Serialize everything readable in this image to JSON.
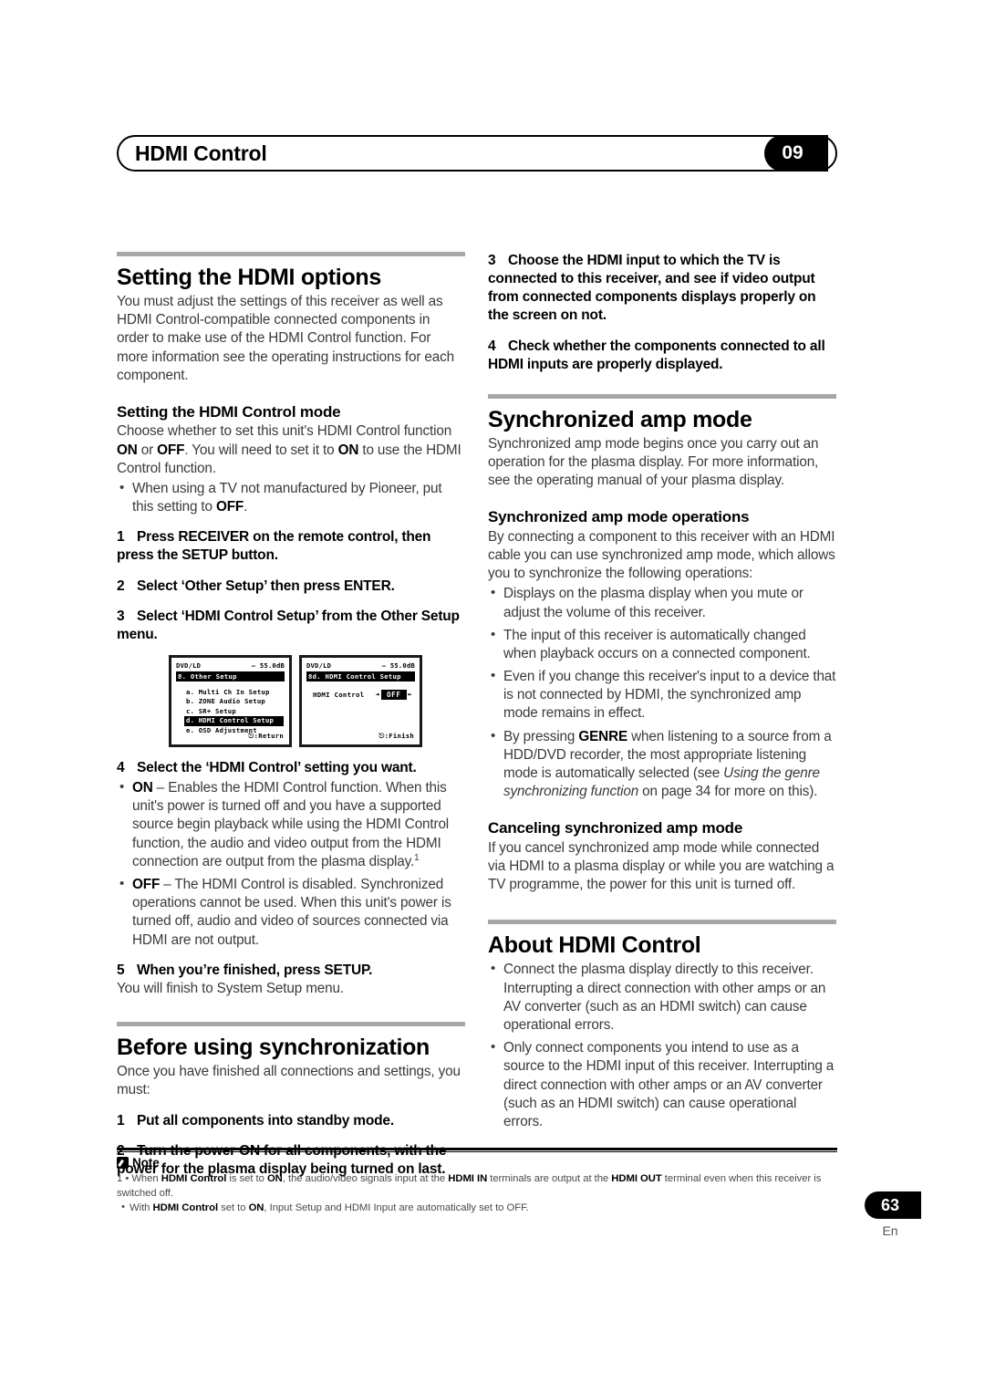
{
  "header": {
    "running_title": "HDMI Control",
    "chapter_number": "09"
  },
  "left_column": {
    "section1": {
      "heading": "Setting the HDMI options",
      "intro": "You must adjust the settings of this receiver as well as HDMI Control-compatible connected components in order to make use of the HDMI Control function. For more information see the operating instructions for each component.",
      "subheading": "Setting the HDMI Control mode",
      "sub_intro_pre": "Choose whether to set this unit's HDMI Control function ",
      "sub_on": "ON",
      "sub_mid1": " or ",
      "sub_off": "OFF",
      "sub_mid2": ". You will need to set it to ",
      "sub_on2": "ON",
      "sub_end": " to use the HDMI Control function.",
      "bullet1_pre": "When using a TV not manufactured by Pioneer, put this setting to ",
      "bullet1_bold": "OFF",
      "bullet1_end": ".",
      "steps": [
        {
          "n": "1",
          "text": "Press RECEIVER on the remote control, then press the SETUP button."
        },
        {
          "n": "2",
          "text": "Select ‘Other Setup’ then press ENTER."
        },
        {
          "n": "3",
          "text": "Select ‘HDMI Control Setup’ from the Other Setup menu."
        }
      ],
      "step4": {
        "n": "4",
        "text": "Select the ‘HDMI Control’ setting you want."
      },
      "step4_bullets": [
        {
          "bold": "ON",
          "text": " – Enables the HDMI Control function. When this unit's power is turned off and you have a supported source begin playback while using the HDMI Control function, the audio and video output from the HDMI connection are output from the plasma display.",
          "footnote": "1"
        },
        {
          "bold": "OFF",
          "text": " – The HDMI Control is disabled. Synchronized operations cannot be used. When this unit's power is turned off, audio and video of sources connected via HDMI are not output.",
          "footnote": ""
        }
      ],
      "step5": {
        "n": "5",
        "text": "When you’re finished, press SETUP."
      },
      "step5_after": "You will finish to System Setup menu."
    },
    "section2": {
      "heading": "Before using synchronization",
      "intro": "Once you have finished all connections and settings, you must:",
      "steps": [
        {
          "n": "1",
          "text": "Put all components into standby mode."
        },
        {
          "n": "2",
          "text": "Turn the power ON for all components, with the power for the plasma display being turned on last."
        }
      ]
    },
    "osd_screens": [
      {
        "source": "DVD/LD",
        "volume": "– 55.0dB",
        "title": "8. Other Setup",
        "items": [
          {
            "label": "a. Multi Ch In Setup",
            "highlighted": false
          },
          {
            "label": "b. ZONE Audio Setup",
            "highlighted": false
          },
          {
            "label": "c. SR+ Setup",
            "highlighted": false
          },
          {
            "label": "d. HDMI Control Setup",
            "highlighted": true
          },
          {
            "label": "e. OSD Adjustment",
            "highlighted": false
          }
        ],
        "footer": ":Return"
      },
      {
        "source": "DVD/LD",
        "volume": "– 55.0dB",
        "title": "8d. HDMI Control Setup",
        "field_label": "HDMI Control",
        "field_value": "OFF",
        "arrow_left": "◄",
        "arrow_right": "►",
        "footer": ":Finish"
      }
    ]
  },
  "right_column": {
    "continued_steps": [
      {
        "n": "3",
        "text": "Choose the HDMI input to which the TV is connected to this receiver, and see if video output from connected components displays properly on the screen on not."
      },
      {
        "n": "4",
        "text": "Check whether the components connected to all HDMI inputs are properly displayed."
      }
    ],
    "section3": {
      "heading": "Synchronized amp mode",
      "intro": "Synchronized amp mode begins once you carry out an operation for the plasma display. For more information, see the operating manual of your plasma display.",
      "subheading": "Synchronized amp mode operations",
      "sub_intro": "By connecting a component to this receiver with an HDMI cable you can use synchronized amp mode, which allows you to synchronize the following operations:",
      "bullets": [
        "Displays on the plasma display when you mute or adjust the volume of this receiver.",
        "The input of this receiver is automatically changed when playback occurs on a connected component.",
        "Even if you change this receiver's input to a device that is not connected by HDMI, the synchronized amp mode remains in effect."
      ],
      "bullet_genre": {
        "pre": "By pressing ",
        "bold": "GENRE",
        "mid": " when listening to a source from a HDD/DVD recorder, the most appropriate listening mode is automatically selected (see ",
        "italic": "Using the genre synchronizing function",
        "post": " on page 34 for more on this)."
      },
      "subheading2": "Canceling synchronized amp mode",
      "sub_intro2": "If you cancel synchronized amp mode while connected via HDMI to a plasma display or while you are watching a TV programme, the power for this unit is turned off."
    },
    "section4": {
      "heading": "About HDMI Control",
      "bullets": [
        "Connect the plasma display directly to this receiver. Interrupting a direct connection with other amps or an AV converter (such as an HDMI switch) can cause operational errors.",
        "Only connect components you intend to use as a source to the HDMI input of this receiver. Interrupting a direct connection with other amps or an AV converter (such as an HDMI switch) can cause operational errors."
      ]
    }
  },
  "note": {
    "title": "Note",
    "line1": {
      "marker": "1",
      "pre": " • When ",
      "b1": "HDMI Control",
      "mid1": " is set to ",
      "b2": "ON",
      "mid2": ", the audio/video signals input at the ",
      "b3": "HDMI IN",
      "mid3": " terminals are output at the ",
      "b4": "HDMI OUT",
      "post": " terminal even when this receiver is switched off."
    },
    "line2": {
      "pre": "With ",
      "b1": "HDMI Control",
      "mid1": " set to ",
      "b2": "ON",
      "post": ", Input Setup and HDMI Input are automatically set to OFF."
    }
  },
  "footer": {
    "page_number": "63",
    "language": "En"
  }
}
